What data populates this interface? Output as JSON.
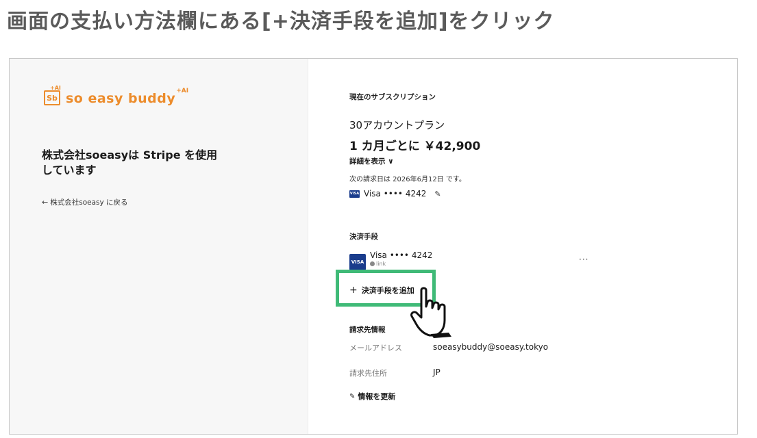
{
  "instruction": "画面の支払い方法欄にある[+決済手段を追加]をクリック",
  "logo": {
    "badge": "Sb",
    "badge_ai": "+AI",
    "text": "so easy buddy",
    "sup": "+AI"
  },
  "left": {
    "merchant_title": "株式会社soeasyは Stripe を使用しています",
    "back_arrow": "←",
    "back_label": "株式会社soeasy に戻る"
  },
  "subscription": {
    "section_label": "現在のサブスクリプション",
    "plan_name": "30アカウントプラン",
    "price": "1 カ月ごとに ￥42,900",
    "details_toggle": "詳細を表示 ∨",
    "next_billing": "次の請求日は 2026年6月12日 です。",
    "card_brand": "VISA",
    "card_label": "Visa •••• 4242",
    "edit_icon": "✎"
  },
  "payment_methods": {
    "heading": "決済手段",
    "card_brand": "VISA",
    "card_label": "Visa •••• 4242",
    "card_sub": "link",
    "more": "···",
    "add_plus": "+",
    "add_label": "決済手段を追加"
  },
  "billing": {
    "heading": "請求先情報",
    "email_key": "メールアドレス",
    "email_value": "soeasybuddy@soeasy.tokyo",
    "address_key": "請求先住所",
    "address_value": "JP",
    "update_icon": "✎",
    "update_label": "情報を更新"
  },
  "colors": {
    "brand_orange": "#ec8c2c",
    "highlight_green": "#3fba77",
    "visa_blue": "#1a3c8c"
  }
}
